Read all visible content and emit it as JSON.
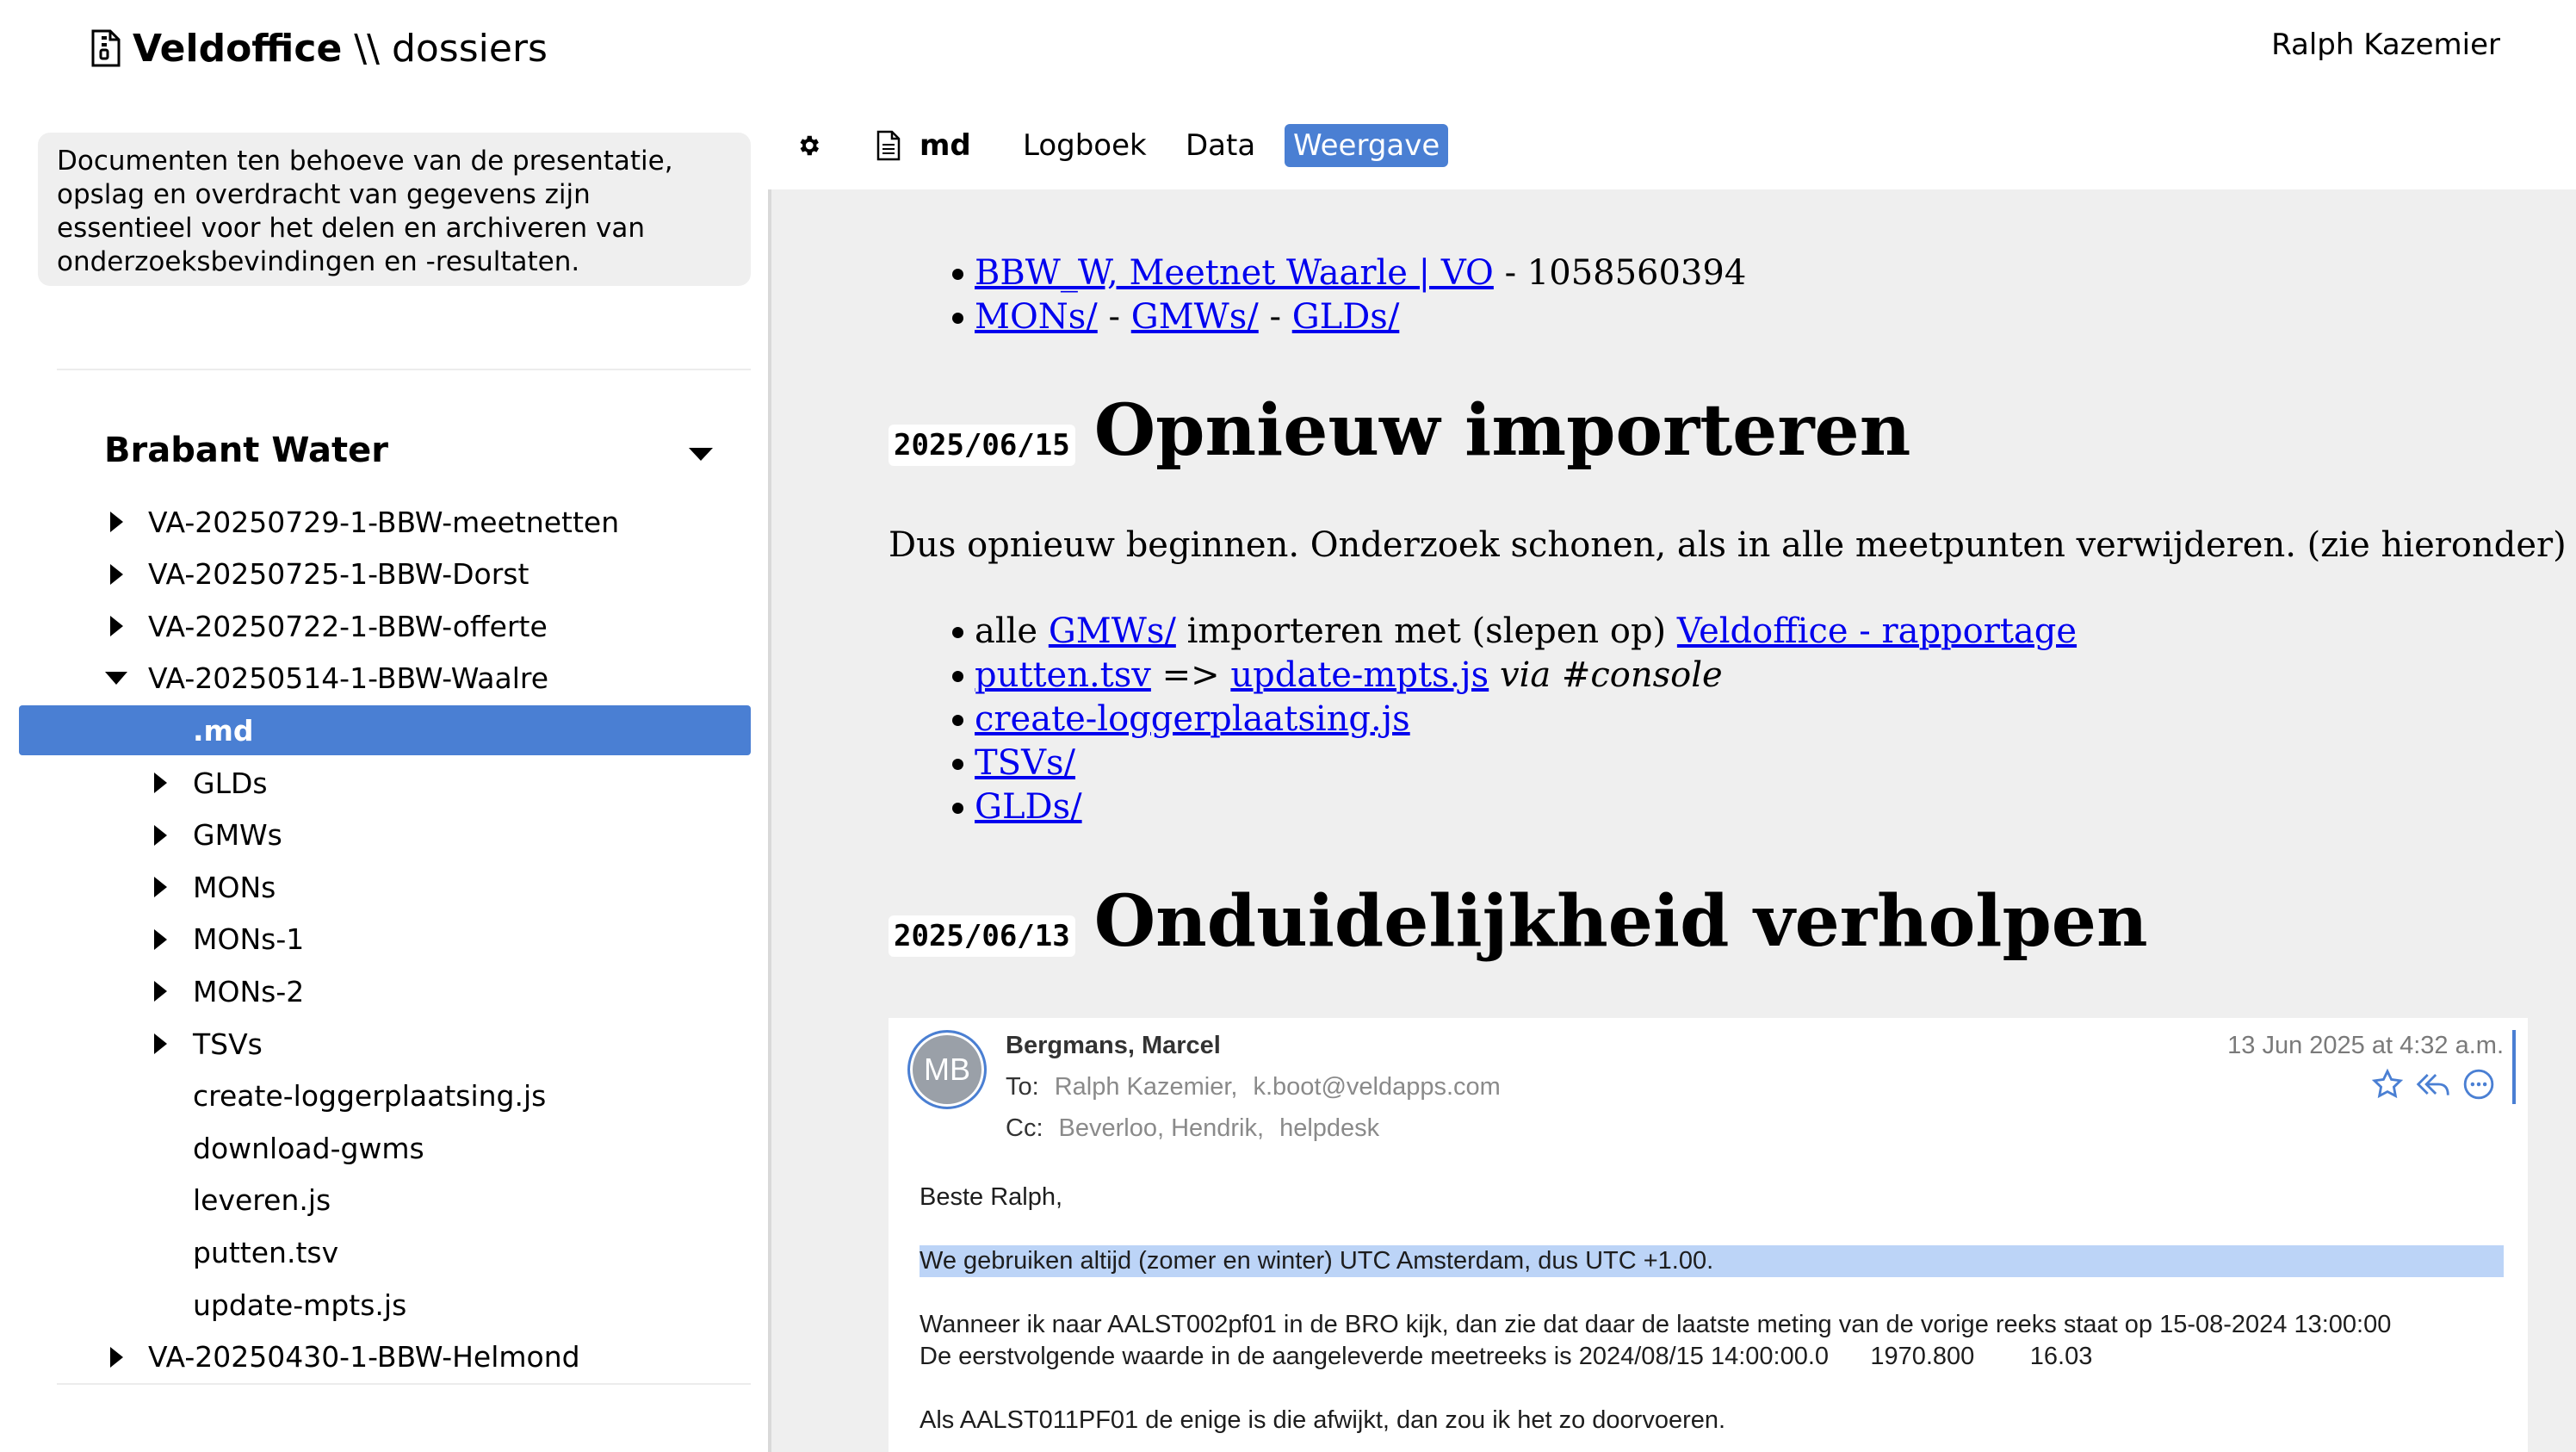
{
  "header": {
    "brand": "Veldoffice",
    "separator": "\\\\",
    "section": "dossiers",
    "user": "Ralph Kazemier"
  },
  "sidebar": {
    "note": "Documenten ten behoeve van de presentatie, opslag en overdracht van gegevens zijn essentieel voor het delen en archiveren van onderzoeksbevindingen en -resultaten.",
    "group_title": "Brabant Water",
    "tree": [
      {
        "label": "VA-20250729-1-BBW-meetnetten",
        "expander": "collapsed"
      },
      {
        "label": "VA-20250725-1-BBW-Dorst",
        "expander": "collapsed"
      },
      {
        "label": "VA-20250722-1-BBW-offerte",
        "expander": "collapsed"
      },
      {
        "label": "VA-20250514-1-BBW-Waalre",
        "expander": "expanded"
      },
      {
        "label": ".md",
        "expander": "none",
        "selected": true
      },
      {
        "label": "GLDs",
        "expander": "collapsed"
      },
      {
        "label": "GMWs",
        "expander": "collapsed"
      },
      {
        "label": "MONs",
        "expander": "collapsed"
      },
      {
        "label": "MONs-1",
        "expander": "collapsed"
      },
      {
        "label": "MONs-2",
        "expander": "collapsed"
      },
      {
        "label": "TSVs",
        "expander": "collapsed"
      },
      {
        "label": "create-loggerplaatsing.js",
        "expander": "none"
      },
      {
        "label": "download-gwms",
        "expander": "none"
      },
      {
        "label": "leveren.js",
        "expander": "none"
      },
      {
        "label": "putten.tsv",
        "expander": "none"
      },
      {
        "label": "update-mpts.js",
        "expander": "none"
      },
      {
        "label": "VA-20250430-1-BBW-Helmond",
        "expander": "collapsed"
      }
    ]
  },
  "toolbar": {
    "file_label": "md",
    "tabs": [
      "Logboek",
      "Data",
      "Weergave"
    ],
    "active_tab": "Weergave"
  },
  "content": {
    "top_links": {
      "line1_link": "BBW_W, Meetnet Waarle | VO",
      "line1_suffix": " - 1058560394",
      "line2_links": [
        "MONs/",
        "GMWs/",
        "GLDs/"
      ],
      "line2_sep": " - "
    },
    "section1": {
      "date": "2025/06/15",
      "title": "Opnieuw importeren",
      "paragraph": "Dus opnieuw beginnen. Onderzoek schonen, als in alle meetpunten verwijderen. (zie hieronder)",
      "bullet1_prefix": "alle ",
      "bullet1_link1": "GMWs/",
      "bullet1_mid": " importeren met (slepen op) ",
      "bullet1_link2": "Veldoffice - rapportage",
      "bullet2_link1": "putten.tsv",
      "bullet2_mid": " => ",
      "bullet2_link2": "update-mpts.js",
      "bullet2_em": "via #console",
      "bullet3_link": "create-loggerplaatsing.js",
      "bullet4_link": "TSVs/",
      "bullet5_link": "GLDs/"
    },
    "section2": {
      "date": "2025/06/13",
      "title": "Onduidelijkheid verholpen"
    },
    "email": {
      "avatar_initials": "MB",
      "from": "Bergmans, Marcel",
      "date": "13 Jun 2025 at 4:32 a.m.",
      "to_label": "To:",
      "to": [
        "Ralph Kazemier,",
        "k.boot@veldapps.com"
      ],
      "cc_label": "Cc:",
      "cc": [
        "Beverloo, Hendrik,",
        "helpdesk"
      ],
      "greeting": "Beste Ralph,",
      "highlight": "We gebruiken altijd (zomer en winter) UTC Amsterdam, dus UTC +1.00.",
      "line1": "Wanneer ik naar AALST002pf01 in de BRO kijk, dan zie dat daar de laatste meting van de vorige reeks staat op 15-08-2024 13:00:00",
      "line2": "De eerstvolgende waarde in de aangeleverde meetreeks is 2024/08/15 14:00:00.0      1970.800        16.03",
      "line3": "Als AALST011PF01 de enige is die afwijkt, dan zou ik het zo doorvoeren."
    }
  },
  "icons": {
    "app": "file-zipper-icon",
    "settings": "gear-icon",
    "file": "document-icon",
    "mail_actions": [
      "star-icon",
      "reply-all-icon",
      "more-icon"
    ]
  },
  "colors": {
    "accent": "#4a7fd3",
    "link": "#0000ee",
    "content_bg": "#efefef",
    "highlight": "#bcd4f7"
  }
}
